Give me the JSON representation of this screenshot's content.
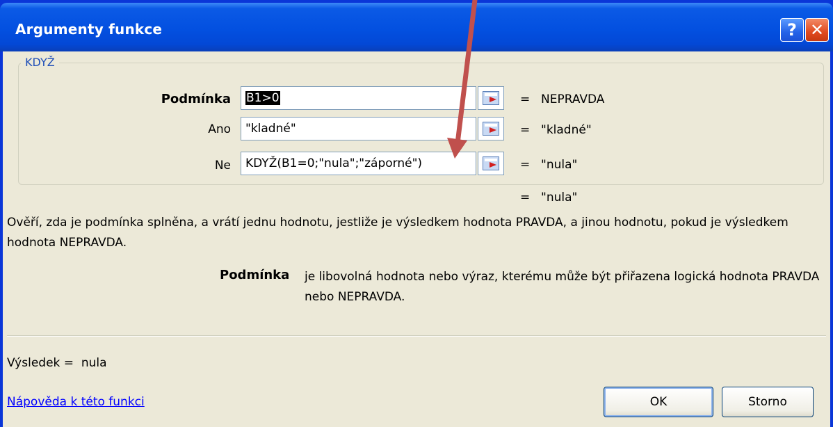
{
  "window": {
    "title": "Argumenty funkce",
    "help_symbol": "?",
    "close_symbol": "✕"
  },
  "function": {
    "name": "KDYŽ",
    "arguments": [
      {
        "label": "Podmínka",
        "value": "B1>0",
        "result": "NEPRAVDA",
        "selected": true,
        "bold": true
      },
      {
        "label": "Ano",
        "value": "\"kladné\"",
        "result": "\"kladné\""
      },
      {
        "label": "Ne",
        "value": "KDYŽ(B1=0;\"nula\";\"záporné\")",
        "result": "\"nula\""
      }
    ],
    "equals": "=",
    "formula_result": "\"nula\""
  },
  "description": "Ověří, zda je podmínka splněna, a vrátí jednu hodnotu, jestliže je výsledkem hodnota PRAVDA, a jinou hodnotu, pokud je výsledkem hodnota NEPRAVDA.",
  "param_help": {
    "name": "Podmínka",
    "text": "je libovolná hodnota nebo výraz, kterému může být přiřazena logická hodnota PRAVDA nebo NEPRAVDA."
  },
  "result_line": {
    "label": "Výsledek =",
    "value": "nula"
  },
  "help_link": "Nápověda k této funkci",
  "buttons": {
    "ok": "OK",
    "cancel": "Storno"
  },
  "colors": {
    "title_bar": "#0350e0",
    "dialog_bg": "#ece9d8",
    "annotation_arrow": "#c0504d",
    "link": "#0000ff"
  },
  "icons": [
    "help-icon",
    "close-icon",
    "collapse-dialog-icon"
  ]
}
